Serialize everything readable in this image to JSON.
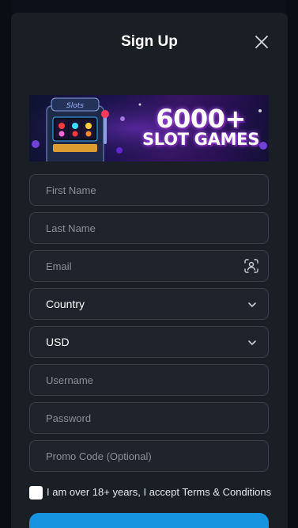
{
  "modal": {
    "title": "Sign Up",
    "close_icon": "close-icon"
  },
  "banner": {
    "headline": "6000+",
    "subline": "SLOT GAMES"
  },
  "form": {
    "first_name_placeholder": "First Name",
    "last_name_placeholder": "Last Name",
    "email_placeholder": "Email",
    "country_value": "Country",
    "currency_value": "USD",
    "username_placeholder": "Username",
    "password_placeholder": "Password",
    "promo_placeholder": "Promo Code (Optional)",
    "terms_label": "I am over 18+ years, I accept Terms & Conditions"
  },
  "colors": {
    "background": "#0b0f17",
    "modal": "#1a1e25",
    "field": "#1f242c",
    "field_border": "#3a404a",
    "accent": "#1794e0"
  }
}
